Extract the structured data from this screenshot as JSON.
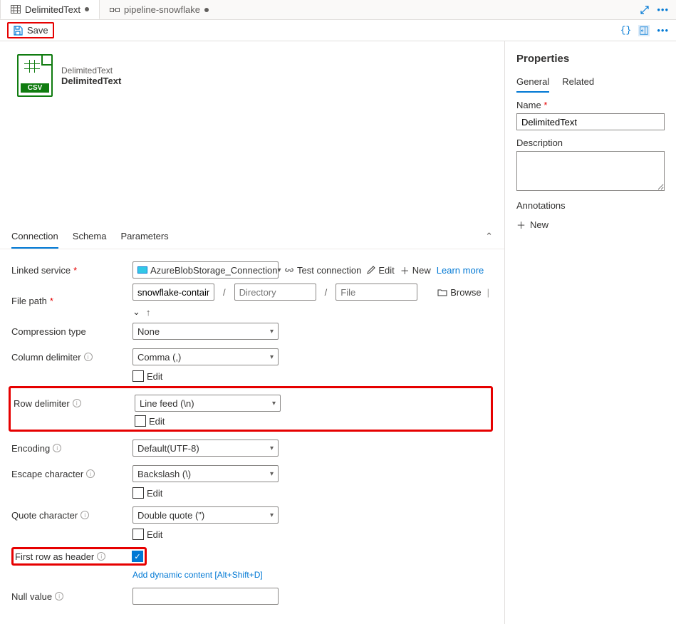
{
  "tabs": [
    {
      "label": "DelimitedText",
      "dirty": true,
      "active": true
    },
    {
      "label": "pipeline-snowflake",
      "dirty": true,
      "active": false
    }
  ],
  "toolbar": {
    "save": "Save"
  },
  "dataset": {
    "type": "DelimitedText",
    "name": "DelimitedText",
    "icon_label": "CSV"
  },
  "content_tabs": {
    "connection": "Connection",
    "schema": "Schema",
    "parameters": "Parameters"
  },
  "form": {
    "linked_service": {
      "label": "Linked service",
      "value": "AzureBlobStorage_Connection",
      "test": "Test connection",
      "edit": "Edit",
      "new": "New",
      "learn": "Learn more"
    },
    "file_path": {
      "label": "File path",
      "container": "snowflake-container",
      "dir_placeholder": "Directory",
      "file_placeholder": "File",
      "browse": "Browse"
    },
    "compression": {
      "label": "Compression type",
      "value": "None"
    },
    "column_delim": {
      "label": "Column delimiter",
      "value": "Comma (,)",
      "edit": "Edit"
    },
    "row_delim": {
      "label": "Row delimiter",
      "value": "Line feed (\\n)",
      "edit": "Edit"
    },
    "encoding": {
      "label": "Encoding",
      "value": "Default(UTF-8)"
    },
    "escape": {
      "label": "Escape character",
      "value": "Backslash (\\)",
      "edit": "Edit"
    },
    "quote": {
      "label": "Quote character",
      "value": "Double quote (\")",
      "edit": "Edit"
    },
    "first_row": {
      "label": "First row as header",
      "dynamic": "Add dynamic content [Alt+Shift+D]"
    },
    "null_value": {
      "label": "Null value"
    }
  },
  "properties": {
    "title": "Properties",
    "tabs": {
      "general": "General",
      "related": "Related"
    },
    "name": {
      "label": "Name",
      "value": "DelimitedText"
    },
    "description": {
      "label": "Description",
      "value": ""
    },
    "annotations": {
      "label": "Annotations",
      "new": "New"
    }
  }
}
